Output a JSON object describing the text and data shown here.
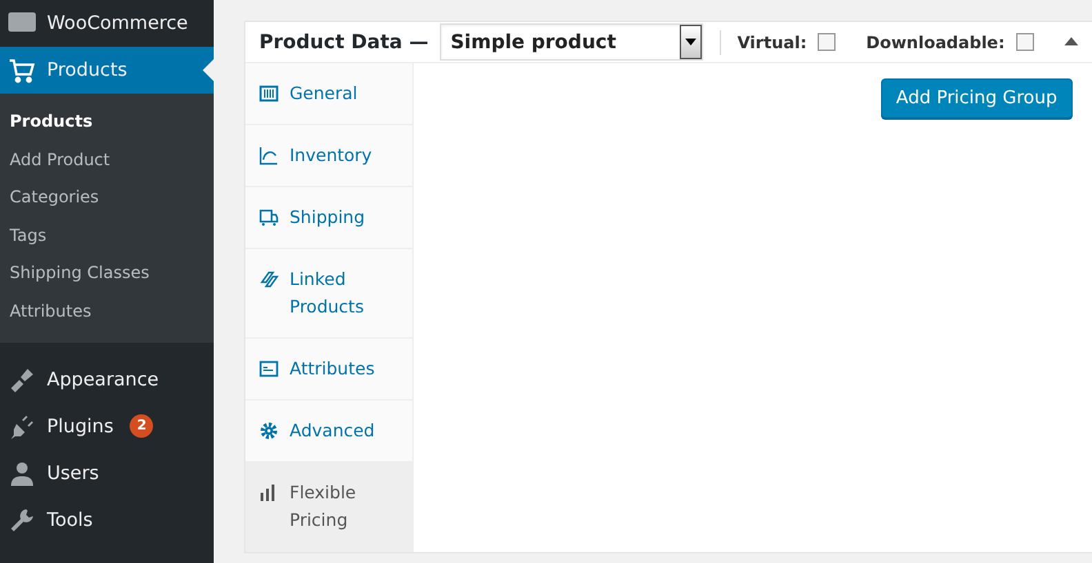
{
  "sidebar": {
    "items": [
      {
        "label": "WooCommerce",
        "selected": false
      },
      {
        "label": "Products",
        "selected": true,
        "children": [
          {
            "label": "Products",
            "selected": true
          },
          {
            "label": "Add Product",
            "selected": false
          },
          {
            "label": "Categories",
            "selected": false
          },
          {
            "label": "Tags",
            "selected": false
          },
          {
            "label": "Shipping Classes",
            "selected": false
          },
          {
            "label": "Attributes",
            "selected": false
          }
        ]
      },
      {
        "label": "Appearance",
        "selected": false
      },
      {
        "label": "Plugins",
        "selected": false,
        "badge": "2"
      },
      {
        "label": "Users",
        "selected": false
      },
      {
        "label": "Tools",
        "selected": false
      }
    ]
  },
  "panel": {
    "title": "Product Data —",
    "product_type": "Simple product",
    "virtual": {
      "label": "Virtual:",
      "checked": false
    },
    "downloadable": {
      "label": "Downloadable:",
      "checked": false
    },
    "tabs": [
      {
        "label": "General",
        "selected": false
      },
      {
        "label": "Inventory",
        "selected": false
      },
      {
        "label": "Shipping",
        "selected": false
      },
      {
        "label": "Linked Products",
        "selected": false
      },
      {
        "label": "Attributes",
        "selected": false
      },
      {
        "label": "Advanced",
        "selected": false
      },
      {
        "label": "Flexible Pricing",
        "selected": true
      }
    ],
    "button": "Add Pricing Group"
  }
}
